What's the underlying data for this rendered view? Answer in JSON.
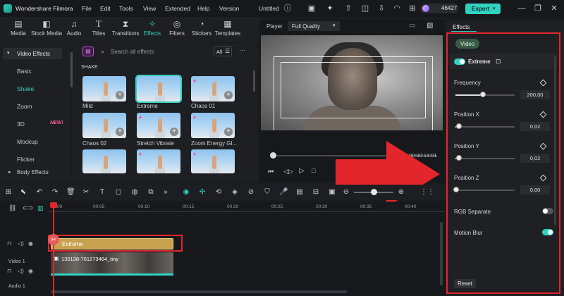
{
  "app": {
    "title": "Wondershare Filmora",
    "menu": [
      "File",
      "Edit",
      "Tools",
      "View",
      "Extended",
      "Help",
      "Version"
    ],
    "project_name": "Untitled",
    "credits": "46427",
    "export_label": "Export"
  },
  "tool_tabs": [
    {
      "label": "Media",
      "icon": "media-icon"
    },
    {
      "label": "Stock Media",
      "icon": "stock-media-icon"
    },
    {
      "label": "Audio",
      "icon": "audio-icon"
    },
    {
      "label": "Titles",
      "icon": "titles-icon"
    },
    {
      "label": "Transitions",
      "icon": "transitions-icon"
    },
    {
      "label": "Effects",
      "icon": "effects-icon",
      "active": true
    },
    {
      "label": "Filters",
      "icon": "filters-icon"
    },
    {
      "label": "Stickers",
      "icon": "stickers-icon"
    },
    {
      "label": "Templates",
      "icon": "templates-icon"
    }
  ],
  "left_panel": {
    "section": "Video Effects",
    "items": [
      "Basic",
      "Shake",
      "Zoom",
      "3D",
      "Mockup",
      "Flicker"
    ],
    "active_item": "Shake",
    "new_badge": "NEW!",
    "bottom_section": "Body Effects"
  },
  "effects": {
    "search_placeholder": "Search all effects",
    "filter_label": "All",
    "category_heading": "SHAKE",
    "items": [
      "Mild",
      "Extreme",
      "Chaos 01",
      "Chaos 02",
      "Stretch Vibrate",
      "Zoom Energy Gl..."
    ]
  },
  "player": {
    "label": "Player",
    "quality": "Full Quality",
    "time": "00:00:14:01"
  },
  "right_panel": {
    "tab": "Effects",
    "subtab": "Video",
    "effect_name": "Extreme",
    "params": [
      {
        "label": "Frequency",
        "value": "200,00",
        "level": 0.45
      },
      {
        "label": "Position X",
        "value": "0,02",
        "level": 0.05
      },
      {
        "label": "Position Y",
        "value": "0,02",
        "level": 0.05
      },
      {
        "label": "Position Z",
        "value": "0,00",
        "level": 0.0
      }
    ],
    "rgb_separate_label": "RGB Separate",
    "motion_blur_label": "Motion Blur",
    "reset_label": "Reset"
  },
  "timeline": {
    "ticks": [
      "00:00",
      "00:05",
      "00:10",
      "00:15",
      "00:20",
      "00:25",
      "00:30",
      "00:35",
      "00:40"
    ],
    "effect_clip": "Extreme",
    "video_clip": "135138-761273464_tiny",
    "video_track_label": "Video 1",
    "audio_track_label": "Audio 1"
  },
  "colors": {
    "accent": "#2fd3c0",
    "highlight_red": "#e3262c",
    "effect_clip": "#c9a24f"
  }
}
